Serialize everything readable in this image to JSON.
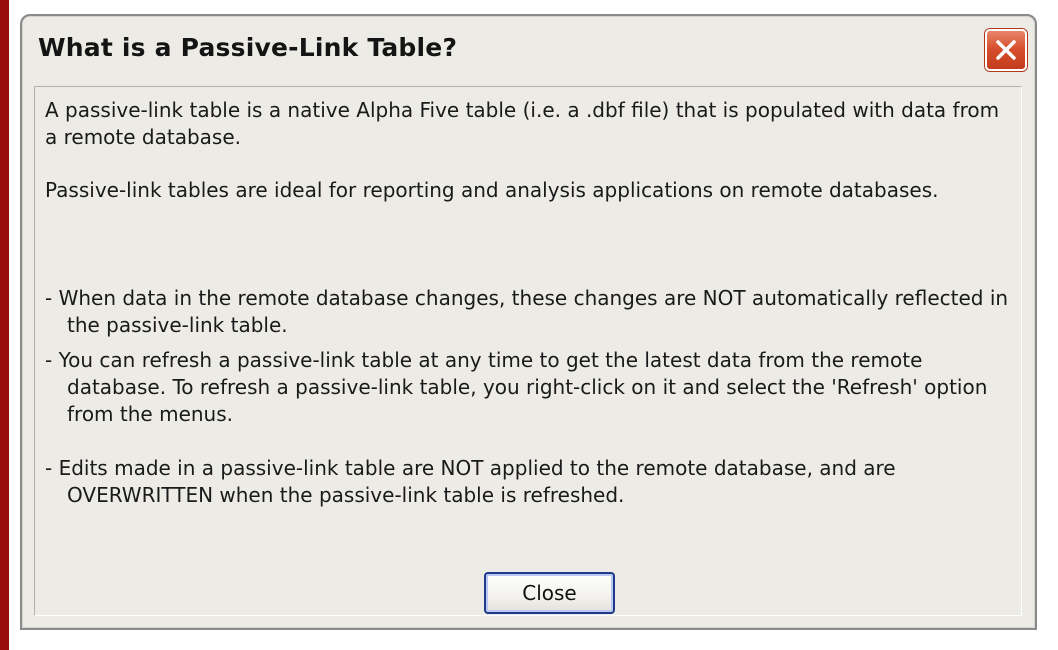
{
  "dialog": {
    "title": "What is a Passive-Link Table?",
    "close_icon": "close-x-icon"
  },
  "content": {
    "paragraphs": [
      "A passive-link table is a native Alpha Five table (i.e. a .dbf file) that is populated with data from a remote database.",
      "Passive-link tables are ideal for reporting and analysis applications on remote databases."
    ],
    "bullets": [
      "- When data in the remote database changes, these changes are NOT automatically reflected in the passive-link table.",
      "- You can refresh a passive-link table at any time to get the latest data from the remote database. To refresh a passive-link table, you right-click on it and select the 'Refresh' option from the menus.",
      "- Edits made in a passive-link table are NOT applied to the remote database, and are OVERWRITTEN when the passive-link table is refreshed."
    ]
  },
  "footer": {
    "close_label": "Close"
  },
  "colors": {
    "background_frame": "#9a0d0d",
    "dialog_bg": "#ecebe6",
    "close_x": "#d6512f",
    "button_border": "#1f3a8a"
  }
}
